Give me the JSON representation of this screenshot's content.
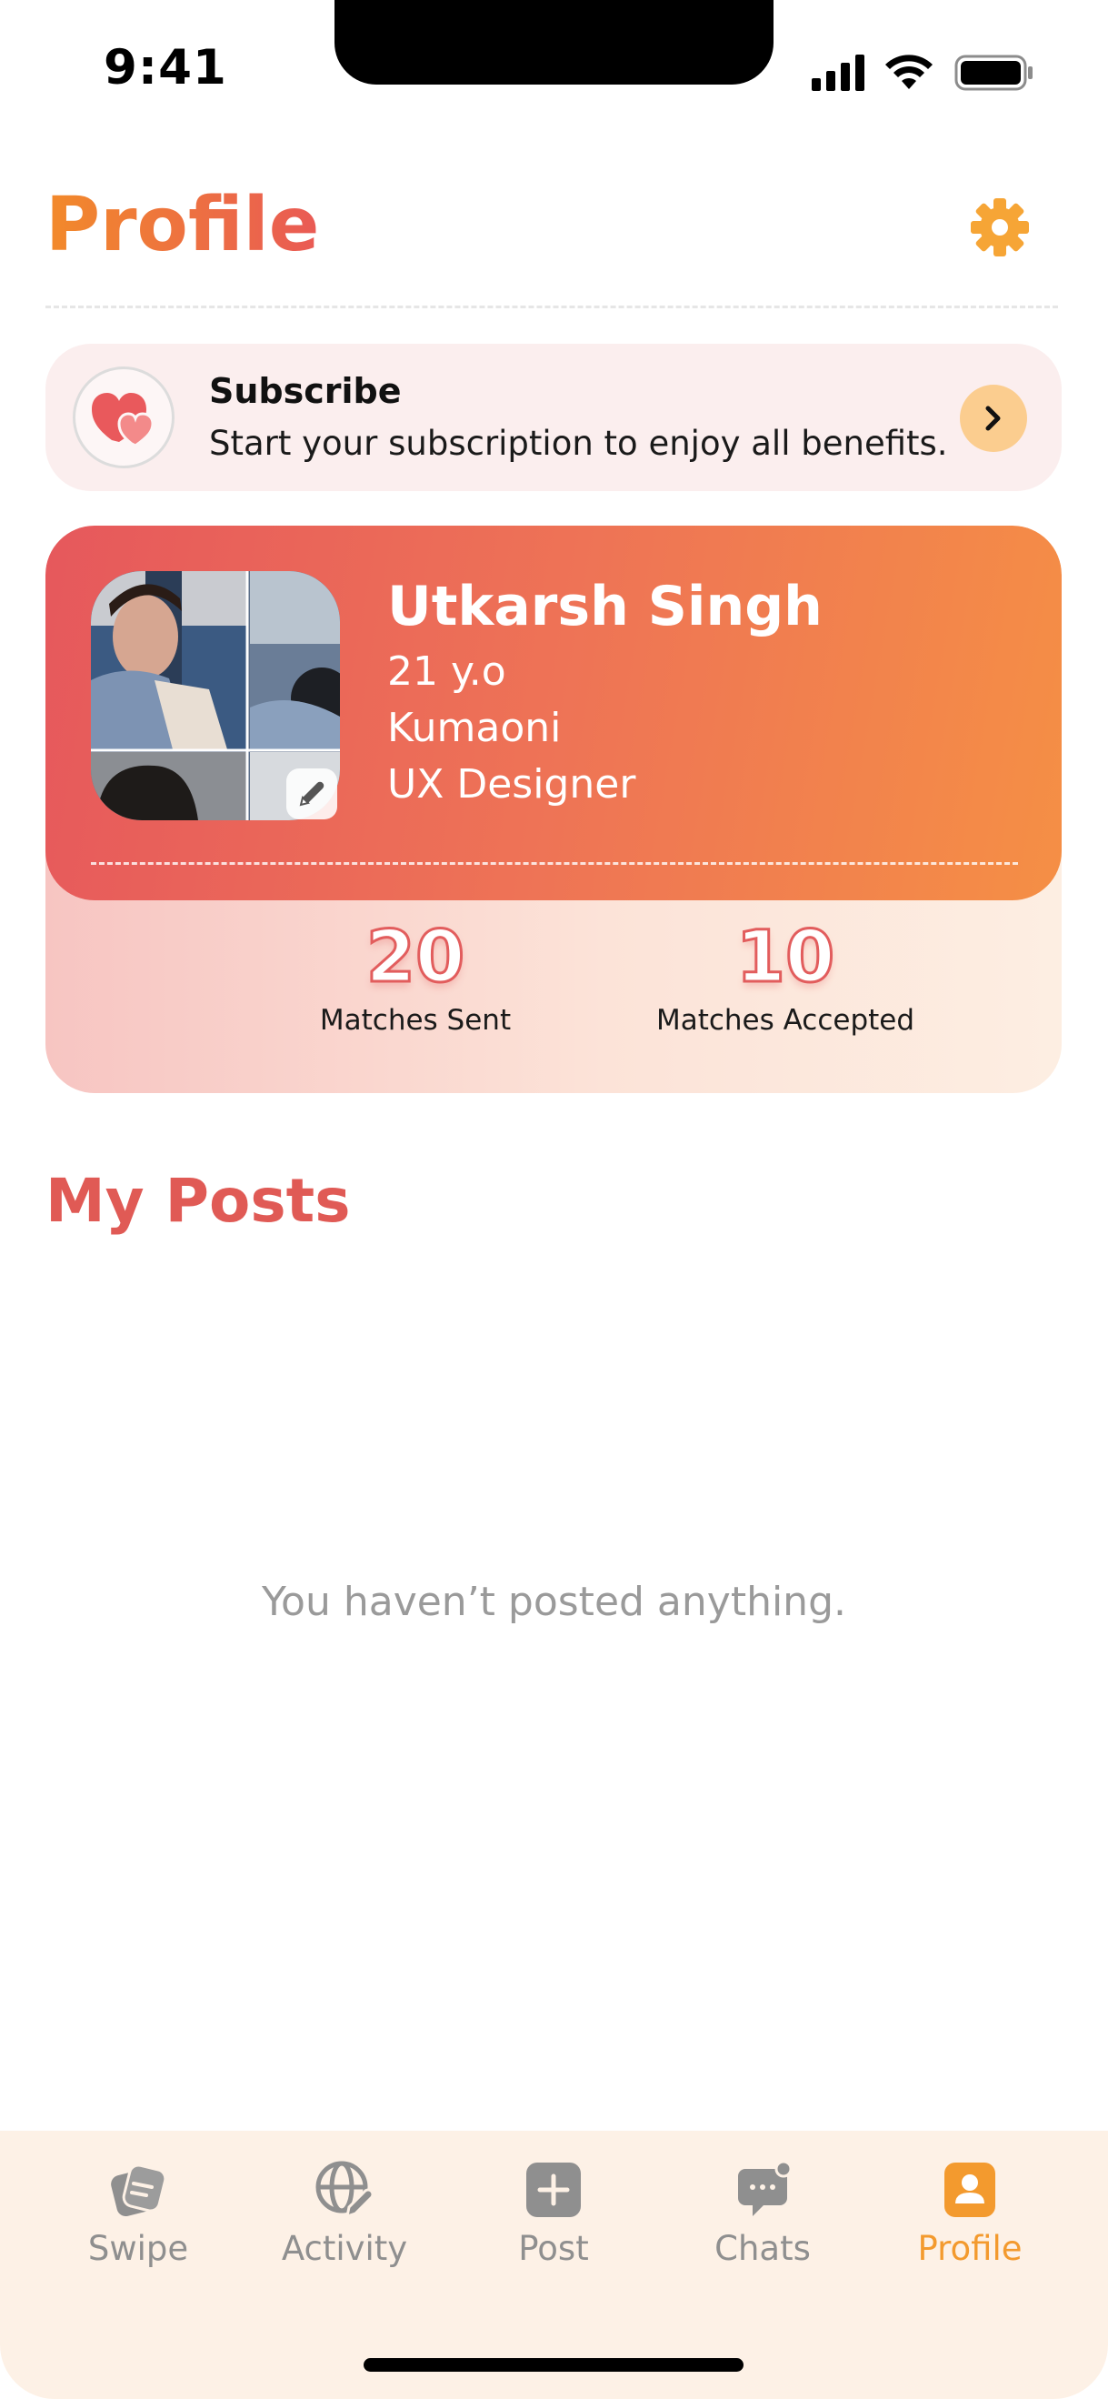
{
  "status_bar": {
    "time": "9:41"
  },
  "header": {
    "title": "Profile"
  },
  "subscribe": {
    "title": "Subscribe",
    "description": "Start your subscription to enjoy all benefits."
  },
  "profile": {
    "name": "Utkarsh Singh",
    "age": "21 y.o",
    "community": "Kumaoni",
    "occupation": "UX Designer"
  },
  "stats": {
    "sent_value": "20",
    "sent_label": "Matches Sent",
    "accepted_value": "10",
    "accepted_label": "Matches Accepted"
  },
  "posts": {
    "title": "My Posts",
    "empty_message": "You haven’t posted anything."
  },
  "tab_bar": {
    "active": "Profile",
    "tabs": [
      {
        "label": "Swipe",
        "icon": "swipe-cards-icon"
      },
      {
        "label": "Activity",
        "icon": "globe-edit-icon"
      },
      {
        "label": "Post",
        "icon": "plus-square-icon"
      },
      {
        "label": "Chats",
        "icon": "chat-bubble-icon"
      },
      {
        "label": "Profile",
        "icon": "user-badge-icon"
      }
    ]
  },
  "colors": {
    "accent_orange": "#f39a2e",
    "accent_red": "#e05a55",
    "inactive_gray": "#8f8f8f"
  }
}
